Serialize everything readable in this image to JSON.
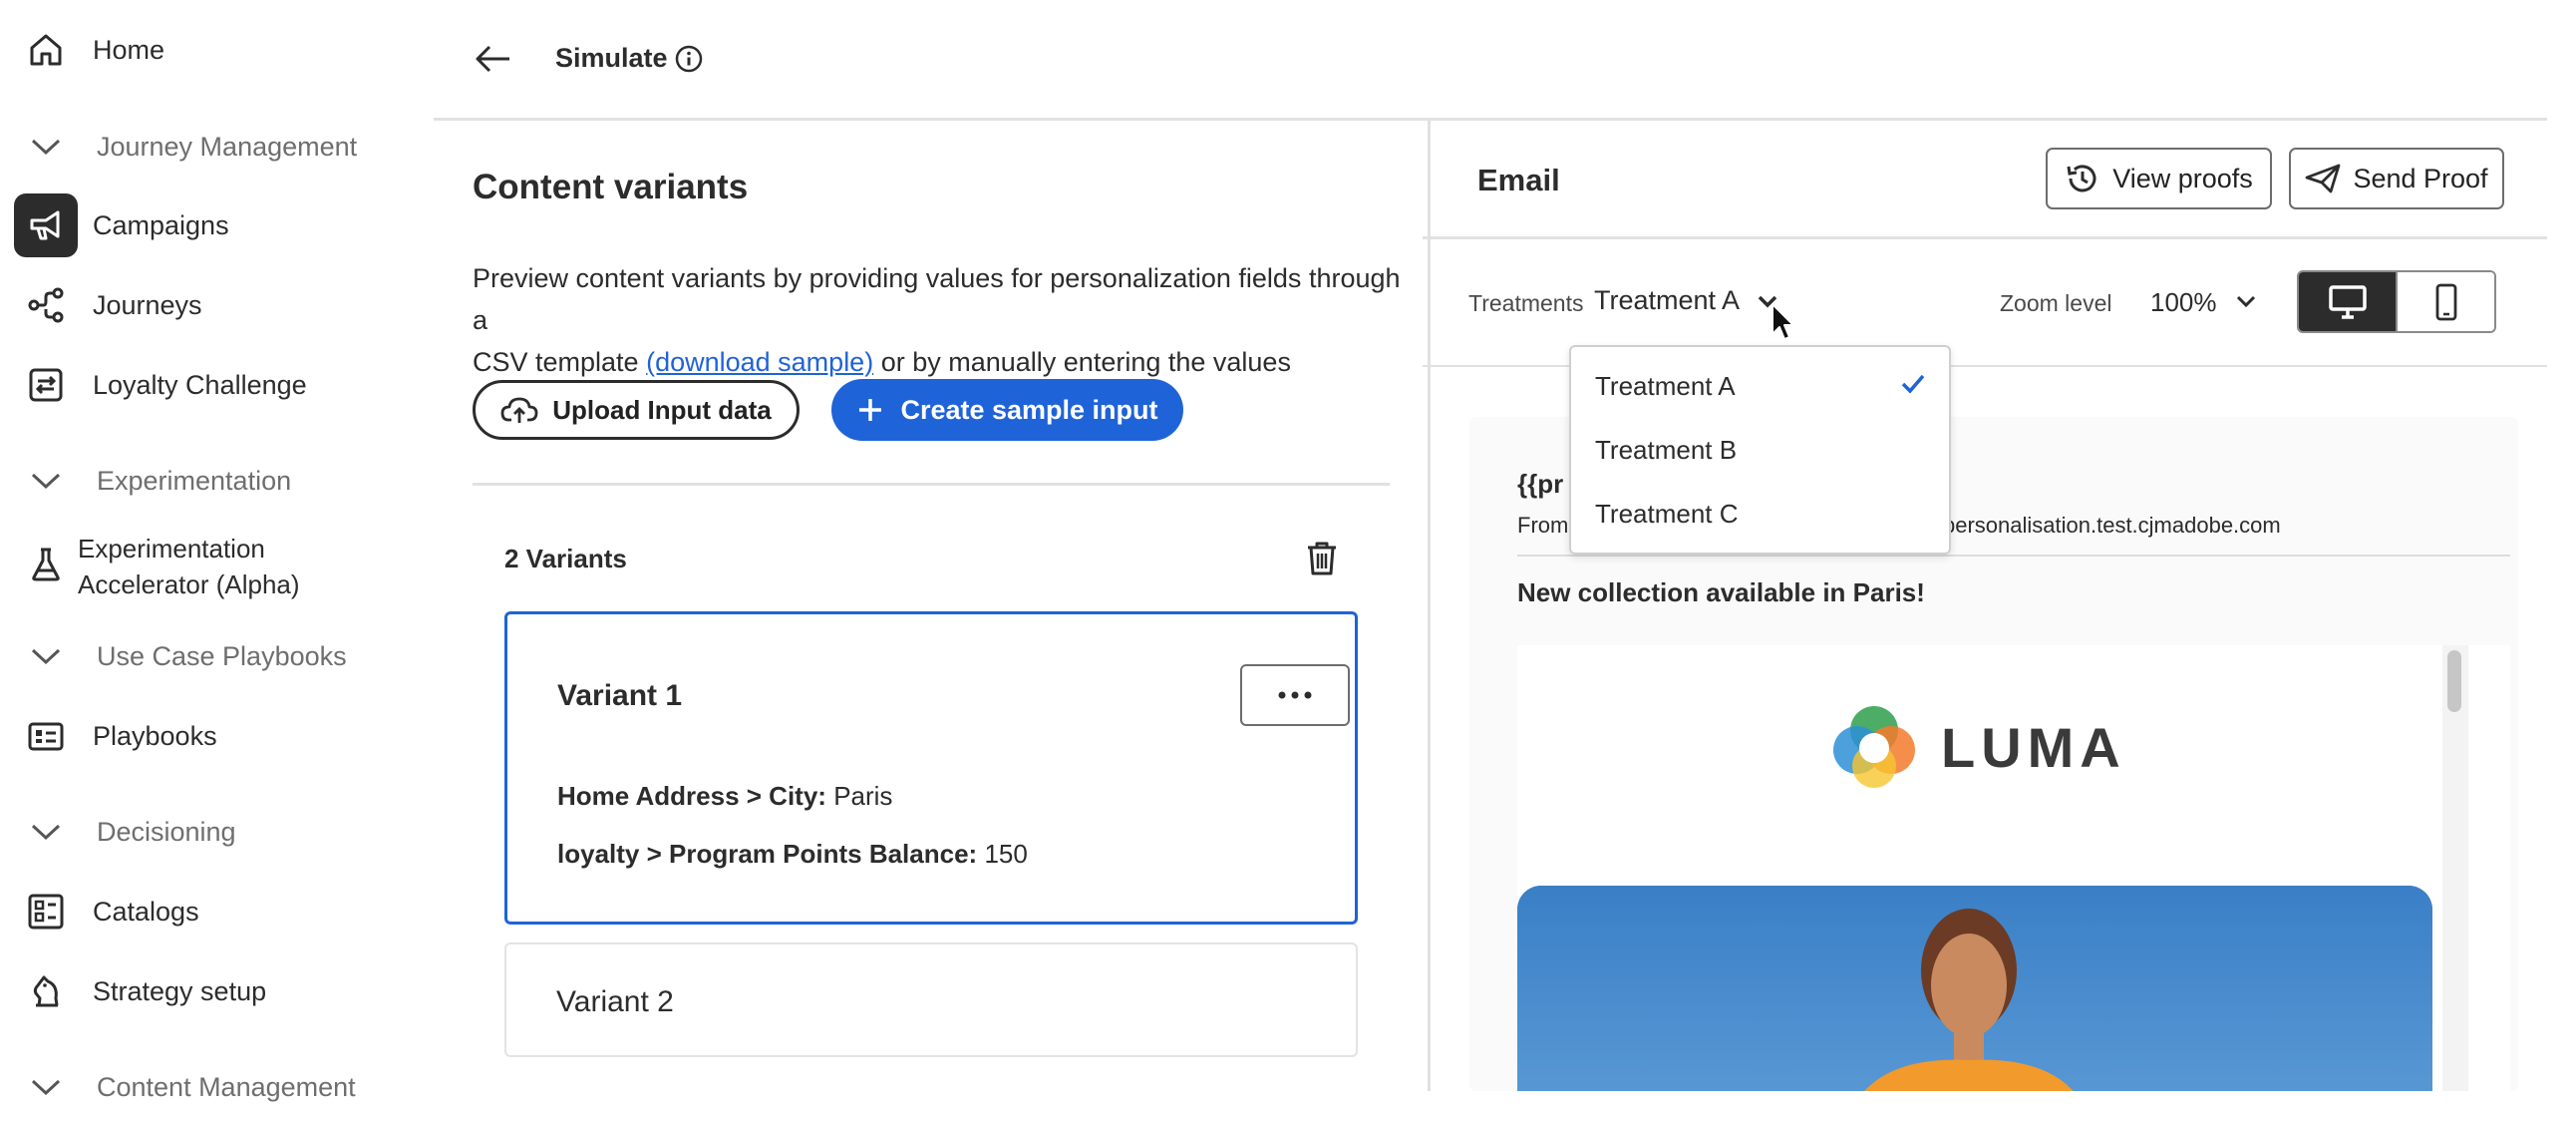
{
  "sidebar": {
    "home": "Home",
    "journey_management": "Journey Management",
    "campaigns": "Campaigns",
    "journeys": "Journeys",
    "loyalty_challenge": "Loyalty Challenge",
    "experimentation": "Experimentation",
    "experimentation_accelerator_line1": "Experimentation",
    "experimentation_accelerator_line2": "Accelerator (Alpha)",
    "use_case_playbooks": "Use Case Playbooks",
    "playbooks": "Playbooks",
    "decisioning": "Decisioning",
    "catalogs": "Catalogs",
    "strategy_setup": "Strategy setup",
    "content_management": "Content Management"
  },
  "header": {
    "title": "Simulate"
  },
  "content_variants": {
    "title": "Content variants",
    "desc_line1": "Preview content variants by providing values for personalization fields through a",
    "desc_line2_pre": "CSV template ",
    "desc_link": "(download sample)",
    "desc_line2_post": " or by manually entering the values",
    "upload_button": "Upload Input data",
    "create_button": "Create sample input",
    "variants_count": "2 Variants",
    "variant1": {
      "title": "Variant 1",
      "field1_label": "Home Address > City:",
      "field1_value": "Paris",
      "field2_label": "loyalty > Program Points Balance:",
      "field2_value": "150"
    },
    "variant2": {
      "title": "Variant 2"
    }
  },
  "email": {
    "title": "Email",
    "view_proofs": "View proofs",
    "send_proof": "Send Proof",
    "treatments_label": "Treatments",
    "treatment_selected": "Treatment A",
    "zoom_label": "Zoom level",
    "zoom_value": "100%",
    "subject_partial": "{{pr",
    "from_partial": "From",
    "from_address_partial": "personalisation.test.cjmadobe.com",
    "headline": "New collection available in Paris!",
    "brand_logo_text": "LUMA",
    "dropdown_options": [
      "Treatment A",
      "Treatment B",
      "Treatment C"
    ],
    "colors": {
      "accent": "#1f63d8",
      "brand_orange": "#f47a2b"
    }
  }
}
